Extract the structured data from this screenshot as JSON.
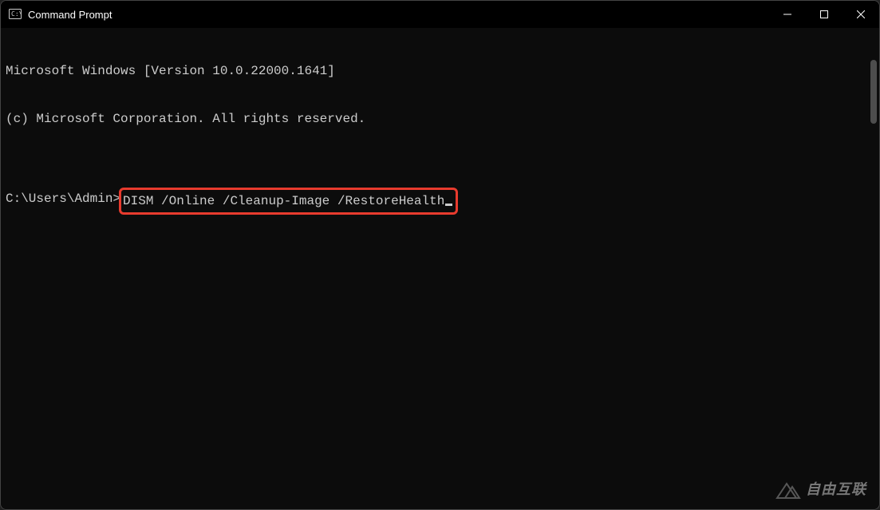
{
  "window": {
    "title": "Command Prompt"
  },
  "terminal": {
    "line1": "Microsoft Windows [Version 10.0.22000.1641]",
    "line2": "(c) Microsoft Corporation. All rights reserved.",
    "blank": "",
    "prompt": "C:\\Users\\Admin>",
    "command": "DISM /Online /Cleanup-Image /RestoreHealth"
  },
  "watermark": {
    "text": "自由互联"
  }
}
